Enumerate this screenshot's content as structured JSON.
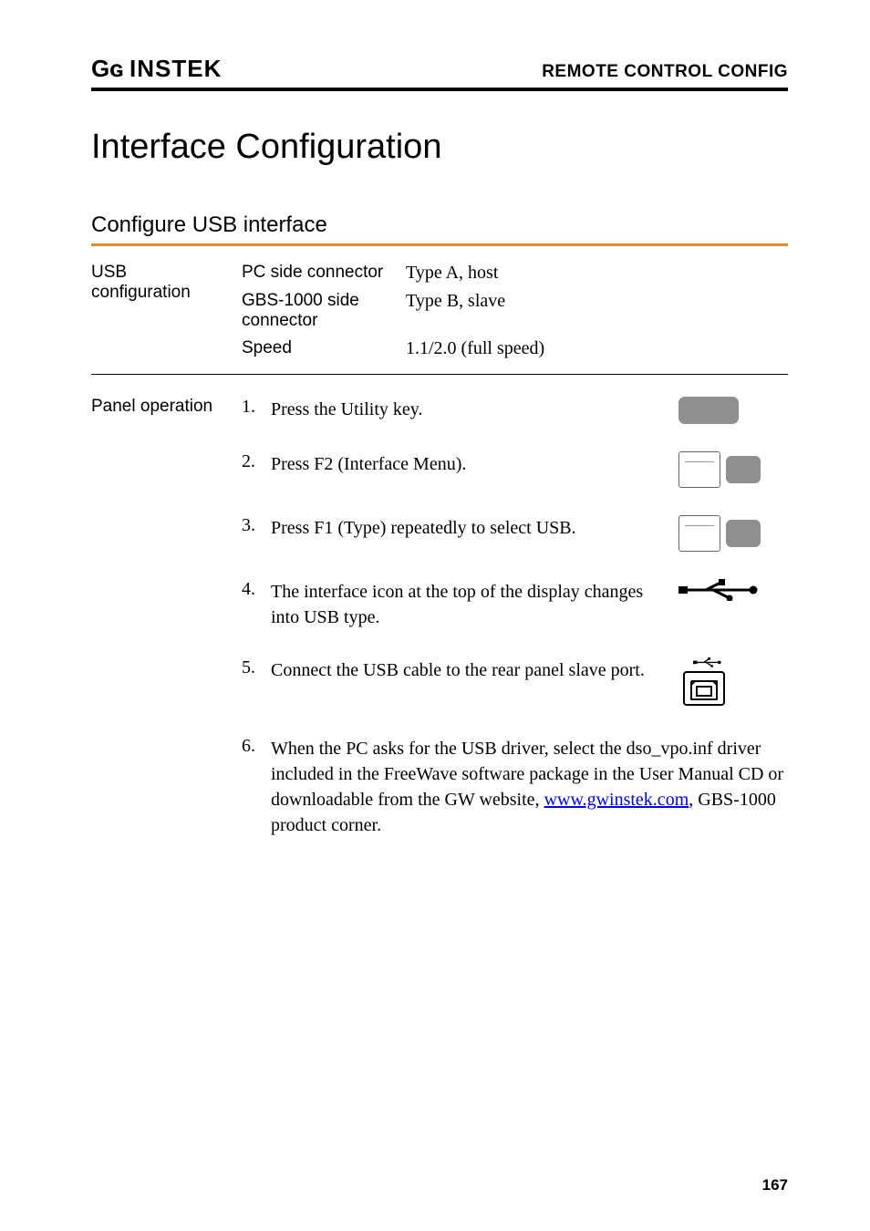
{
  "header": {
    "brand_text": "GWINSTEK",
    "section_label": "REMOTE CONTROL CONFIG"
  },
  "title": "Interface Configuration",
  "section": {
    "heading": "Configure USB interface"
  },
  "usb_config": {
    "row_label_line1": "USB",
    "row_label_line2": "configuration",
    "rows": [
      {
        "key": "PC side connector",
        "value": "Type A, host"
      },
      {
        "key": "GBS-1000 side connector",
        "value": "Type B, slave"
      },
      {
        "key": "Speed",
        "value": "1.1/2.0 (full speed)"
      }
    ]
  },
  "panel": {
    "label": "Panel operation",
    "steps": [
      {
        "n": "1.",
        "text": "Press the Utility key."
      },
      {
        "n": "2.",
        "text": "Press F2 (Interface Menu)."
      },
      {
        "n": "3.",
        "text": "Press F1 (Type) repeatedly to select USB."
      },
      {
        "n": "4.",
        "text": "The interface icon at the top of the display changes into USB type."
      },
      {
        "n": "5.",
        "text": "Connect the USB cable to the rear panel slave port."
      },
      {
        "n": "6.",
        "text_prefix": "When the PC asks for the USB driver, select the dso_vpo.inf driver included in the FreeWave software package in the User Manual CD or downloadable from the GW website, ",
        "link_text": "www.gwinstek.com",
        "text_suffix": ", GBS-1000 product corner."
      }
    ]
  },
  "page_number": "167"
}
